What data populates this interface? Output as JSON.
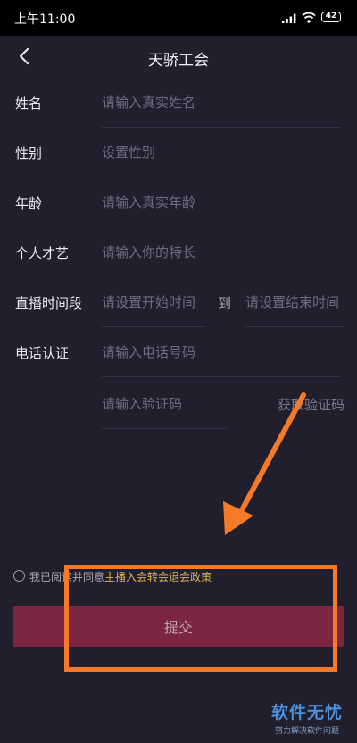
{
  "status_bar": {
    "time": "上午11:00",
    "battery": "42"
  },
  "nav": {
    "title": "天骄工会"
  },
  "form": {
    "name": {
      "label": "姓名",
      "placeholder": "请输入真实姓名"
    },
    "gender": {
      "label": "性别",
      "placeholder": "设置性别"
    },
    "age": {
      "label": "年龄",
      "placeholder": "请输入真实年龄"
    },
    "talent": {
      "label": "个人才艺",
      "placeholder": "请输入你的特长"
    },
    "schedule": {
      "label": "直播时间段",
      "start_placeholder": "请设置开始时间",
      "to": "到",
      "end_placeholder": "请设置结束时间"
    },
    "phone": {
      "label": "电话认证",
      "placeholder": "请输入电话号码"
    },
    "code": {
      "placeholder": "请输入验证码",
      "get_code": "获取验证码"
    }
  },
  "agreement": {
    "prefix": "我已阅读并同意",
    "policy": "主播入会转会退会政策"
  },
  "submit": {
    "label": "提交",
    "color": "#7b2540"
  },
  "annotation": {
    "color": "#f47a2a"
  },
  "watermark": {
    "title": "软件无忧",
    "subtitle": "努力解决软件问题"
  }
}
